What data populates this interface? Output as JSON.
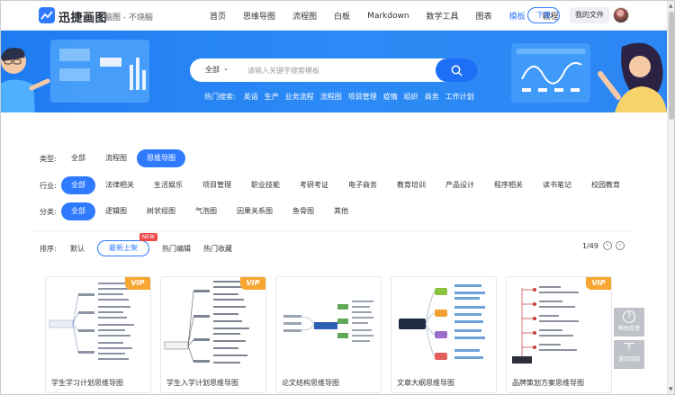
{
  "colors": {
    "accent": "#2f7bff",
    "banner": "#2284f3",
    "vip": "#f7a631",
    "new_badge": "#f04848"
  },
  "header": {
    "brand": "迅捷画图",
    "slogan": "脑图 - 不烧脑",
    "nav": [
      "首页",
      "思维导图",
      "流程图",
      "白板",
      "Markdown",
      "数学工具",
      "图表",
      "模板",
      "教程"
    ],
    "nav_active_index": 7,
    "download_label": "下载",
    "my_files_label": "我的文件"
  },
  "search": {
    "scope": "全部",
    "placeholder": "请输入关键字搜索模板",
    "hot_label": "热门搜索:",
    "hot_terms": [
      "英语",
      "生产",
      "业务流程",
      "流程图",
      "项目管理",
      "疫情",
      "组织",
      "商务",
      "工作计划"
    ]
  },
  "filters": {
    "type": {
      "label": "类型:",
      "options": [
        "全部",
        "流程图",
        "思维导图"
      ],
      "active": 2
    },
    "industry": {
      "label": "行业:",
      "options": [
        "全部",
        "法律相关",
        "生活娱乐",
        "项目管理",
        "职业技能",
        "考研考证",
        "电子商务",
        "教育培训",
        "产品设计",
        "程序相关",
        "读书笔记",
        "校园教育"
      ],
      "active": 0
    },
    "category": {
      "label": "分类:",
      "options": [
        "全部",
        "逻辑图",
        "树状组图",
        "气泡图",
        "因果关系图",
        "鱼骨图",
        "其他"
      ],
      "active": 0
    }
  },
  "sort": {
    "label": "排序:",
    "options": [
      "默认",
      "最新上架",
      "热门编辑",
      "热门收藏"
    ],
    "active": 1,
    "new_badge": "NEW"
  },
  "pager": {
    "text": "1/49",
    "prev": "‹",
    "next": "›"
  },
  "cards": [
    {
      "title": "学生学习计划思维导图",
      "vip": "VIP"
    },
    {
      "title": "学生入学计划思维导图",
      "vip": "VIP"
    },
    {
      "title": "论文结构思维导图",
      "vip": ""
    },
    {
      "title": "文章大纲思维导图",
      "vip": ""
    },
    {
      "title": "品牌策划方案思维导图",
      "vip": "VIP"
    }
  ],
  "float": {
    "help_label": "帮助反馈",
    "top_label": "返回顶部"
  }
}
